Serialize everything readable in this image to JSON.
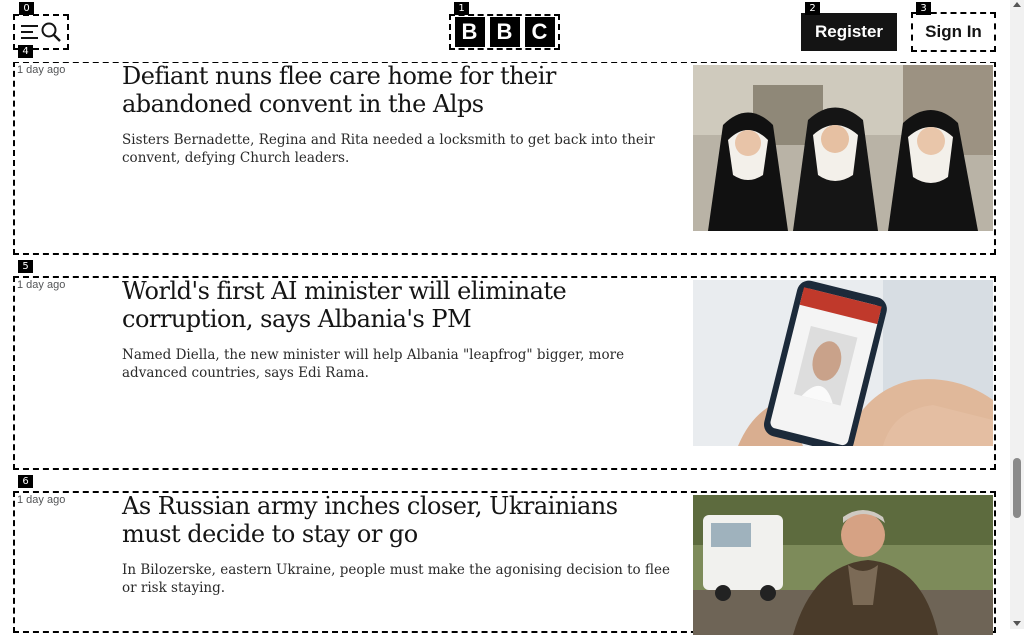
{
  "header": {
    "logo_letters": [
      "B",
      "B",
      "C"
    ],
    "register_label": "Register",
    "signin_label": "Sign In"
  },
  "tags": [
    "0",
    "1",
    "2",
    "3",
    "4",
    "5",
    "6"
  ],
  "articles": [
    {
      "time": "1 day ago",
      "headline": "Defiant nuns flee care home for their abandoned convent in the Alps",
      "summary": "Sisters Bernadette, Regina and Rita needed a locksmith to get back into their convent, defying Church leaders."
    },
    {
      "time": "1 day ago",
      "headline": "World's first AI minister will eliminate corruption, says Albania's PM",
      "summary": "Named Diella, the new minister will help Albania \"leapfrog\" bigger, more advanced countries, says Edi Rama."
    },
    {
      "time": "1 day ago",
      "headline": "As Russian army inches closer, Ukrainians must decide to stay or go",
      "summary": "In Bilozerske, eastern Ukraine, people must make the agonising decision to flee or risk staying."
    }
  ],
  "icons": {
    "menu": "menu-icon",
    "search": "search-icon"
  },
  "colors": {
    "register_bg": "#141414",
    "text": "#141414",
    "timestamp": "#545658"
  }
}
